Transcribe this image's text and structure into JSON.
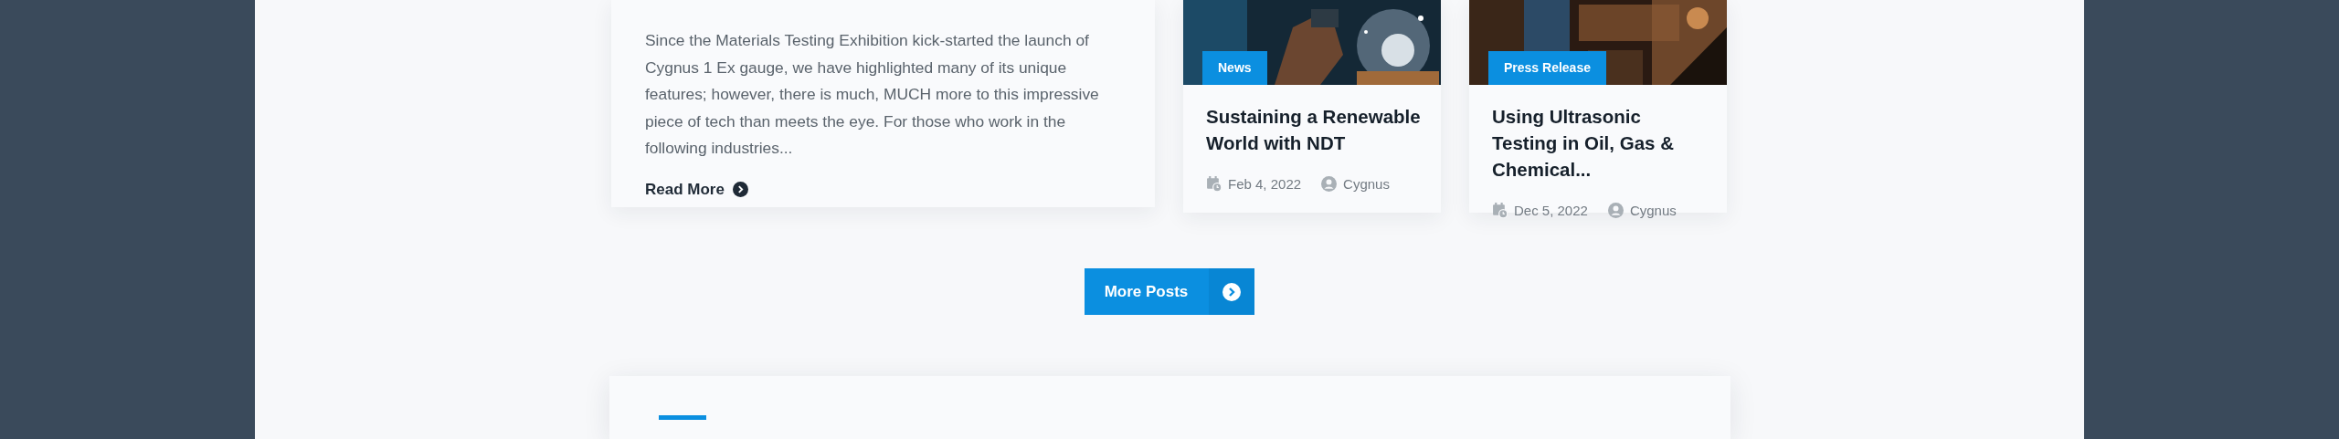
{
  "featured_post": {
    "excerpt": "Since the Materials Testing Exhibition kick-started the launch of Cygnus 1 Ex gauge, we have highlighted many of its unique features; however, there is much, MUCH more to this impressive piece of tech than meets the eye. For those who work in the following industries...",
    "read_more": "Read More"
  },
  "posts": [
    {
      "category": "News",
      "title": "Sustaining a Renewable World with NDT",
      "date": "Feb 4, 2022",
      "author": "Cygnus"
    },
    {
      "category": "Press Release",
      "title": "Using Ultrasonic Testing in Oil, Gas & Chemical...",
      "date": "Dec 5, 2022",
      "author": "Cygnus"
    }
  ],
  "more_posts_button": "More Posts"
}
